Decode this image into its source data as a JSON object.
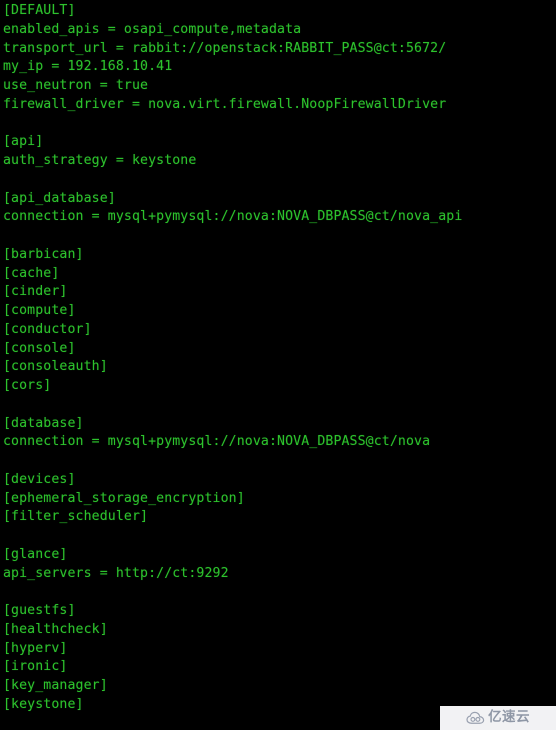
{
  "terminal": {
    "background_color": "#000000",
    "text_color": "#2dc22d",
    "font_size_px": 13.2,
    "line_height_px": 18.76,
    "lines": [
      "[DEFAULT]",
      "enabled_apis = osapi_compute,metadata",
      "transport_url = rabbit://openstack:RABBIT_PASS@ct:5672/",
      "my_ip = 192.168.10.41",
      "use_neutron = true",
      "firewall_driver = nova.virt.firewall.NoopFirewallDriver",
      "",
      "[api]",
      "auth_strategy = keystone",
      "",
      "[api_database]",
      "connection = mysql+pymysql://nova:NOVA_DBPASS@ct/nova_api",
      "",
      "[barbican]",
      "[cache]",
      "[cinder]",
      "[compute]",
      "[conductor]",
      "[console]",
      "[consoleauth]",
      "[cors]",
      "",
      "[database]",
      "connection = mysql+pymysql://nova:NOVA_DBPASS@ct/nova",
      "",
      "[devices]",
      "[ephemeral_storage_encryption]",
      "[filter_scheduler]",
      "",
      "[glance]",
      "api_servers = http://ct:9292",
      "",
      "[guestfs]",
      "[healthcheck]",
      "[hyperv]",
      "[ironic]",
      "[key_manager]",
      "[keystone]"
    ]
  },
  "watermark": {
    "text": "亿速云",
    "icon": "cloud-icon",
    "background_color": "#f2f2f4",
    "text_color": "#8f97a6"
  }
}
